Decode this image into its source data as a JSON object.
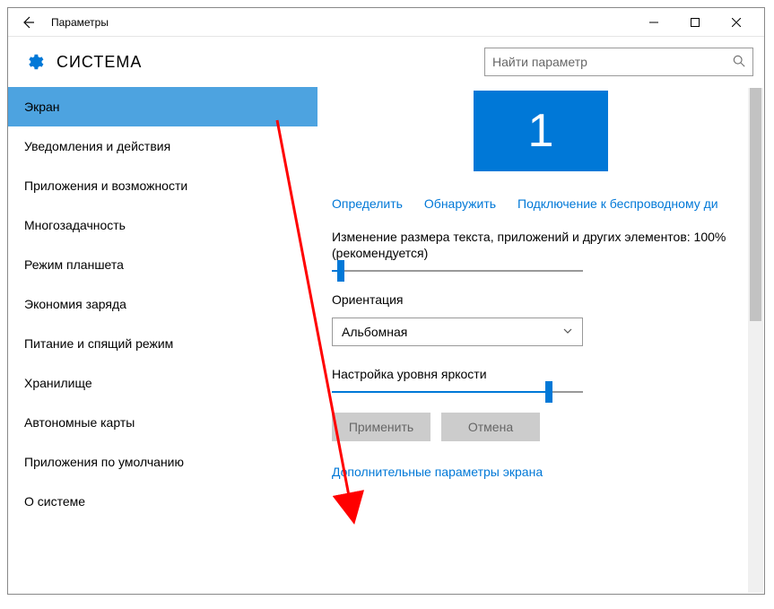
{
  "titlebar": {
    "app_title": "Параметры"
  },
  "header": {
    "section_title": "СИСТЕМА",
    "search_placeholder": "Найти параметр"
  },
  "sidebar": {
    "items": [
      {
        "label": "Экран",
        "active": true
      },
      {
        "label": "Уведомления и действия"
      },
      {
        "label": "Приложения и возможности"
      },
      {
        "label": "Многозадачность"
      },
      {
        "label": "Режим планшета"
      },
      {
        "label": "Экономия заряда"
      },
      {
        "label": "Питание и спящий режим"
      },
      {
        "label": "Хранилище"
      },
      {
        "label": "Автономные карты"
      },
      {
        "label": "Приложения по умолчанию"
      },
      {
        "label": "О системе"
      }
    ]
  },
  "content": {
    "monitor_number": "1",
    "links": {
      "identify": "Определить",
      "detect": "Обнаружить",
      "wireless": "Подключение к беспроводному ди"
    },
    "scale_label": "Изменение размера текста, приложений и других элементов: 100% (рекомендуется)",
    "scale_slider": {
      "percent": 2
    },
    "orientation_label": "Ориентация",
    "orientation_value": "Альбомная",
    "brightness_label": "Настройка уровня яркости",
    "brightness_slider": {
      "percent": 85
    },
    "apply_btn": "Применить",
    "cancel_btn": "Отмена",
    "advanced_link": "Дополнительные параметры экрана"
  }
}
